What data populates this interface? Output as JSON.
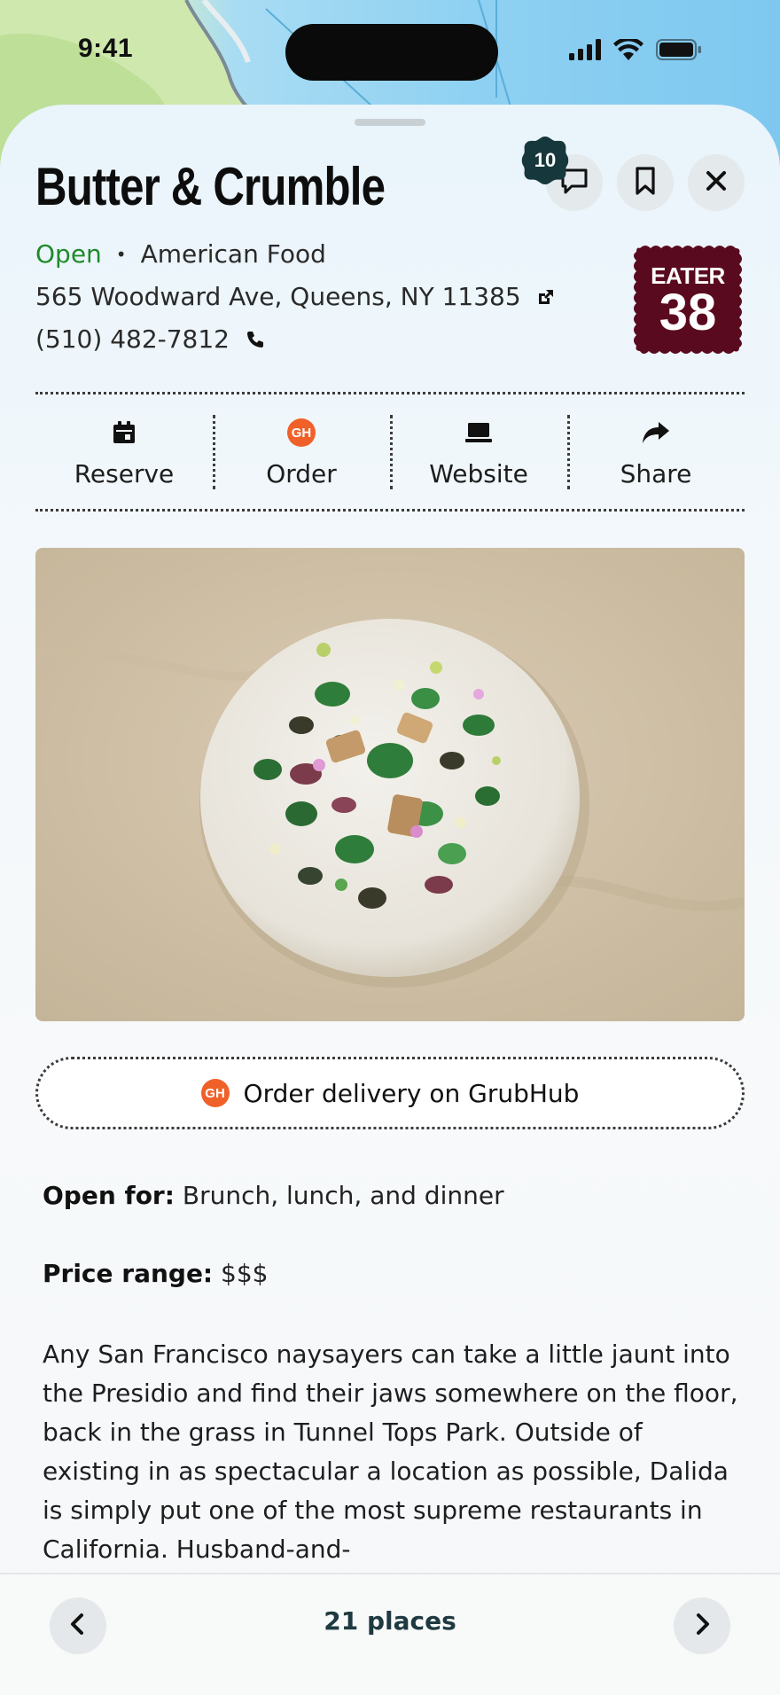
{
  "status_bar": {
    "time": "9:41"
  },
  "place": {
    "name": "Butter & Crumble",
    "status": "Open",
    "cuisine": "American Food",
    "address": "565 Woodward Ave, Queens, NY 11385",
    "phone": "(510) 482-7812",
    "comment_count": "10",
    "badge": {
      "word": "EATER",
      "number": "38",
      "color": "#5a0a1e"
    }
  },
  "actions": [
    {
      "label": "Reserve",
      "icon": "calendar-icon"
    },
    {
      "label": "Order",
      "icon": "grubhub-icon"
    },
    {
      "label": "Website",
      "icon": "laptop-icon"
    },
    {
      "label": "Share",
      "icon": "share-icon"
    }
  ],
  "grubhub": {
    "logo_text": "GH",
    "cta": "Order delivery on GrubHub",
    "color": "#f0612a"
  },
  "info": {
    "open_for_label": "Open for:",
    "open_for_value": "Brunch, lunch, and dinner",
    "price_label": "Price range:",
    "price_value": "$$$"
  },
  "description": "Any San Francisco naysayers can take a little jaunt into the Presidio and find their jaws somewhere on the floor, back in the grass in Tunnel Tops Park. Outside of existing in as spectacular a location as possible, Dalida is simply put one of the most supreme restaurants in California. Husband-and-",
  "footer": {
    "places_label": "21 places"
  },
  "colors": {
    "open_green": "#1f8a2b",
    "badge_dark": "#16383c",
    "accent_text": "#1e3a40"
  }
}
